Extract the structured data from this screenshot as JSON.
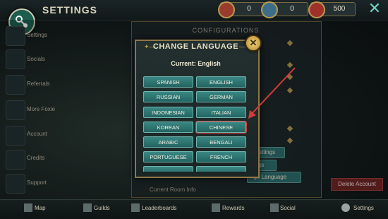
{
  "header": {
    "title": "SETTINGS",
    "resources": [
      {
        "value": "0"
      },
      {
        "value": "0"
      },
      {
        "value": "500"
      }
    ]
  },
  "sidebar": {
    "items": [
      {
        "label": "Settings"
      },
      {
        "label": "Socials"
      },
      {
        "label": "Referrals"
      },
      {
        "label": "More Foxie"
      },
      {
        "label": "Account"
      },
      {
        "label": "Credits"
      },
      {
        "label": "Support"
      }
    ]
  },
  "background_panel": {
    "header": "CONFIGURATIONS",
    "row_fragments": [
      "a",
      "e On",
      "d",
      "r",
      "f",
      "wn"
    ],
    "buttons": [
      "y Settings",
      "ttings",
      "nge Language"
    ],
    "current_room_info": "Current Room Info",
    "delete_account": "Delete Account"
  },
  "dialog": {
    "title": "CHANGE LANGUAGE",
    "current": "Current: English",
    "languages": [
      "SPANISH",
      "ENGLISH",
      "RUSSIAN",
      "GERMAN",
      "INDONESIAN",
      "ITALIAN",
      "KOREAN",
      "CHINESE",
      "ARABIC",
      "BENGALI",
      "PORTUGUESE",
      "FRENCH",
      "",
      ""
    ],
    "highlighted": "CHINESE"
  },
  "bottom_nav": [
    {
      "label": "Map"
    },
    {
      "label": "Guilds"
    },
    {
      "label": "Leaderboards"
    },
    {
      "label": "Rewards"
    },
    {
      "label": "Social"
    },
    {
      "label": "Settings"
    }
  ],
  "colors": {
    "accent_teal": "#2c6d6b",
    "frame_gold": "#8d7748",
    "annotation_red": "#d63a3a"
  }
}
